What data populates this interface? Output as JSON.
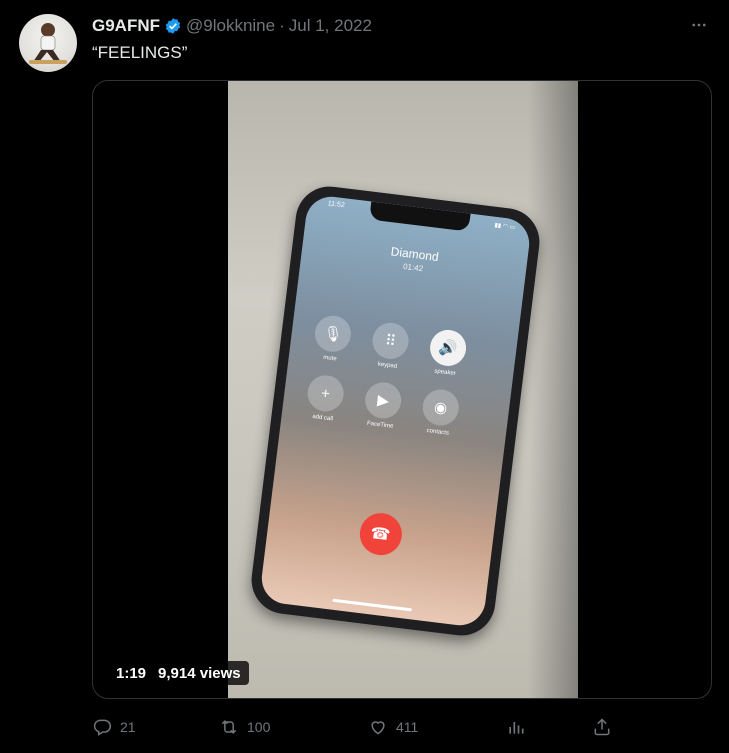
{
  "tweet": {
    "display_name": "G9AFNF",
    "handle": "@9lokknine",
    "separator": "·",
    "date": "Jul 1, 2022",
    "text": "“FEELINGS”"
  },
  "video": {
    "duration": "1:19",
    "views": "9,914 views",
    "phone_screen": {
      "status_time": "11:52",
      "caller_name": "Diamond",
      "call_timer": "01:42",
      "buttons": {
        "mute": "mute",
        "keypad": "keypad",
        "speaker": "speaker",
        "add_call": "add call",
        "facetime": "FaceTime",
        "contacts": "contacts"
      }
    }
  },
  "actions": {
    "replies": "21",
    "reposts": "100",
    "likes": "411"
  },
  "icons": [
    "verified-badge-icon",
    "more-icon",
    "reply-icon",
    "repost-icon",
    "like-icon",
    "views-icon",
    "share-icon"
  ],
  "colors": {
    "verified_blue": "#1d9bf0",
    "muted_text": "#71767b",
    "end_call_red": "#f0443a"
  }
}
